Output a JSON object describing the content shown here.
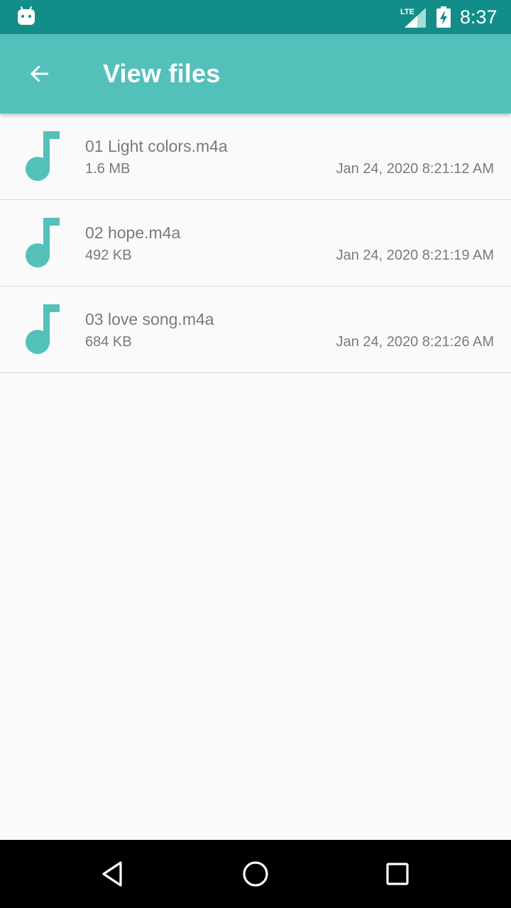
{
  "status_bar": {
    "network_label": "LTE",
    "time": "8:37",
    "icons": [
      "android-notification-icon",
      "lte-signal-icon",
      "battery-charging-icon"
    ]
  },
  "app_bar": {
    "title": "View files",
    "back_icon": "arrow-back-icon"
  },
  "colors": {
    "status_bar": "#138d89",
    "app_bar": "#54c0ba",
    "accent_icon": "#54c0ba",
    "text_secondary": "#7a7a7a",
    "background": "#fafafa",
    "nav_bar": "#000000"
  },
  "files": [
    {
      "name": "01 Light colors.m4a",
      "size": "1.6 MB",
      "date": "Jan 24, 2020 8:21:12 AM",
      "icon": "music-note-icon"
    },
    {
      "name": "02 hope.m4a",
      "size": "492 KB",
      "date": "Jan 24, 2020 8:21:19 AM",
      "icon": "music-note-icon"
    },
    {
      "name": "03 love song.m4a",
      "size": "684 KB",
      "date": "Jan 24, 2020 8:21:26 AM",
      "icon": "music-note-icon"
    }
  ],
  "nav_bar": {
    "buttons": [
      "back-triangle-icon",
      "home-circle-icon",
      "recents-square-icon"
    ]
  }
}
